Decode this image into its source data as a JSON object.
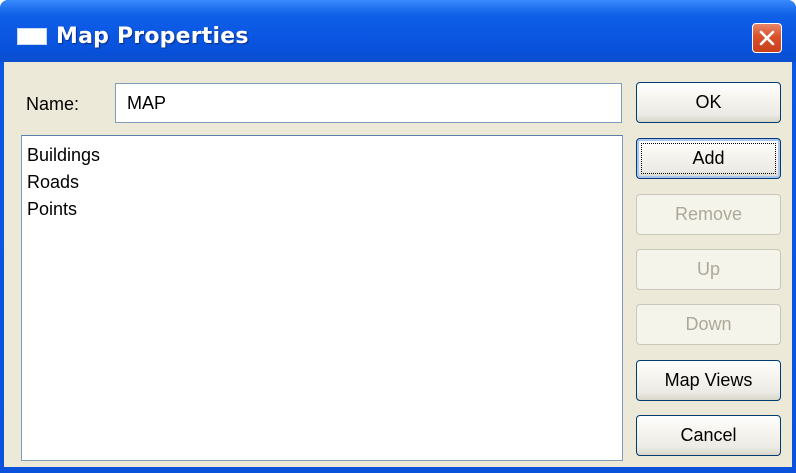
{
  "window": {
    "title": "Map Properties",
    "title_icon": "window-icon",
    "close_icon": "close-icon"
  },
  "form": {
    "name_label": "Name:",
    "name_value": "MAP"
  },
  "list": {
    "items": [
      "Buildings",
      "Roads",
      "Points"
    ]
  },
  "buttons": {
    "ok": "OK",
    "add": "Add",
    "remove": "Remove",
    "up": "Up",
    "down": "Down",
    "map_views": "Map Views",
    "cancel": "Cancel"
  },
  "colors": {
    "titlebar": "#0a56e2",
    "dialog_background": "#ece9d8",
    "close_button": "#d9502a",
    "disabled_text": "#aca899"
  }
}
